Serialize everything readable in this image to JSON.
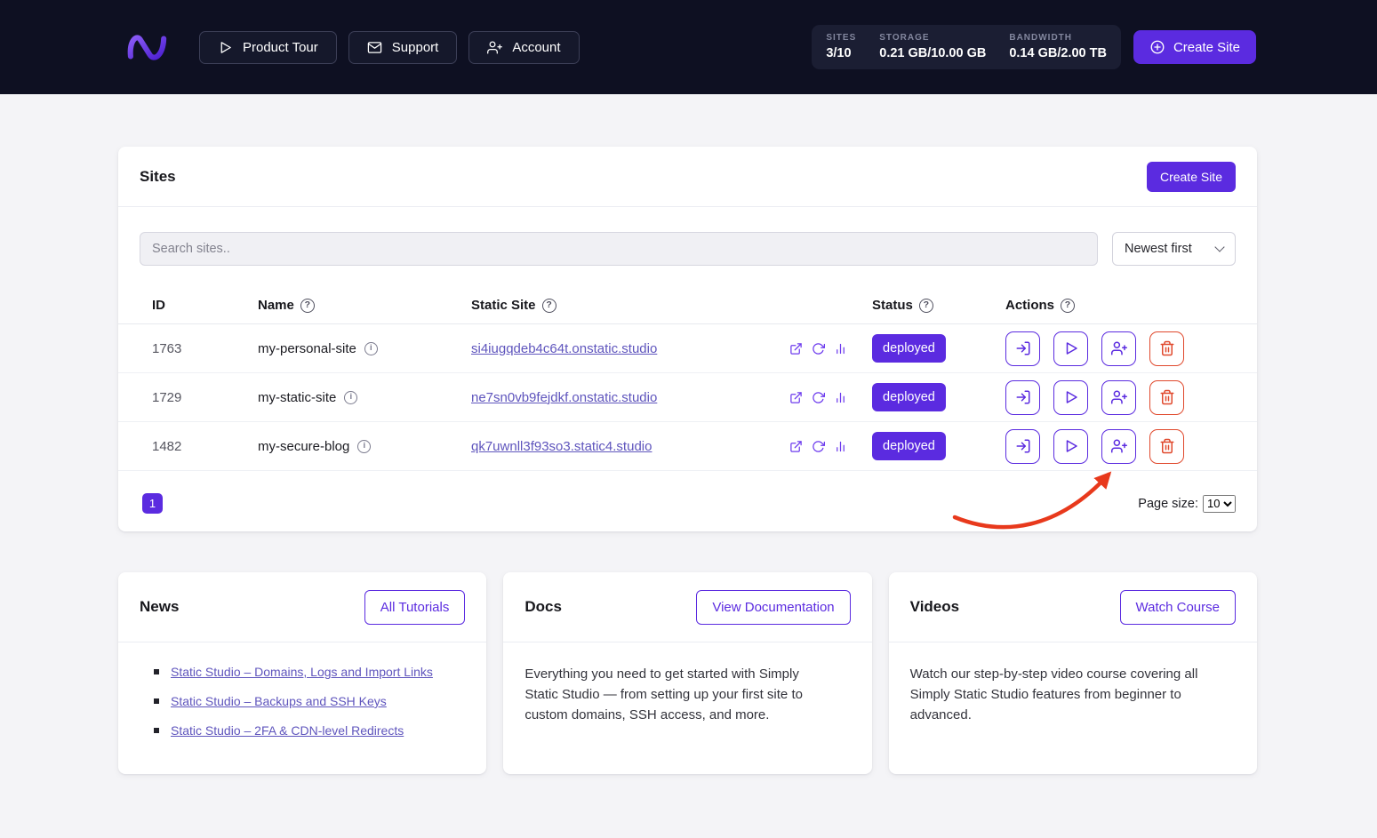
{
  "ui": {
    "help_glyph": "?",
    "info_glyph": "i"
  },
  "colors": {
    "accent": "#5b2be0",
    "danger": "#e0482c",
    "arrow": "#e8391c",
    "topbar_bg": "#0e1022"
  },
  "topbar": {
    "nav": [
      {
        "label": "Product Tour",
        "icon": "play-icon"
      },
      {
        "label": "Support",
        "icon": "mail-icon"
      },
      {
        "label": "Account",
        "icon": "user-plus-icon"
      }
    ],
    "stats": [
      {
        "label": "SITES",
        "value": "3/10"
      },
      {
        "label": "STORAGE",
        "value": "0.21 GB/10.00 GB"
      },
      {
        "label": "BANDWIDTH",
        "value": "0.14 GB/2.00 TB"
      }
    ],
    "create_site_label": "Create Site"
  },
  "sites_card": {
    "title": "Sites",
    "create_site_label": "Create Site",
    "search_placeholder": "Search sites..",
    "sort_value": "Newest first",
    "columns": [
      "ID",
      "Name",
      "Static Site",
      "Status",
      "Actions"
    ],
    "rows": [
      {
        "id": "1763",
        "name": "my-personal-site",
        "static_site": "si4iugqdeb4c64t.onstatic.studio",
        "status": "deployed"
      },
      {
        "id": "1729",
        "name": "my-static-site",
        "static_site": "ne7sn0vb9fejdkf.onstatic.studio",
        "status": "deployed"
      },
      {
        "id": "1482",
        "name": "my-secure-blog",
        "static_site": "qk7uwnll3f93so3.static4.studio",
        "status": "deployed"
      }
    ],
    "pagination": {
      "page": "1"
    },
    "page_size": {
      "label": "Page size:",
      "value": "10"
    }
  },
  "cards": {
    "news": {
      "title": "News",
      "button": "All Tutorials",
      "links": [
        "Static Studio – Domains, Logs and Import Links",
        "Static Studio – Backups and SSH Keys",
        "Static Studio – 2FA & CDN-level Redirects"
      ]
    },
    "docs": {
      "title": "Docs",
      "button": "View Documentation",
      "body": "Everything you need to get started with Simply Static Studio — from setting up your first site to custom domains, SSH access, and more."
    },
    "videos": {
      "title": "Videos",
      "button": "Watch Course",
      "body": "Watch our step-by-step video course covering all Simply Static Studio features from beginner to advanced."
    }
  }
}
